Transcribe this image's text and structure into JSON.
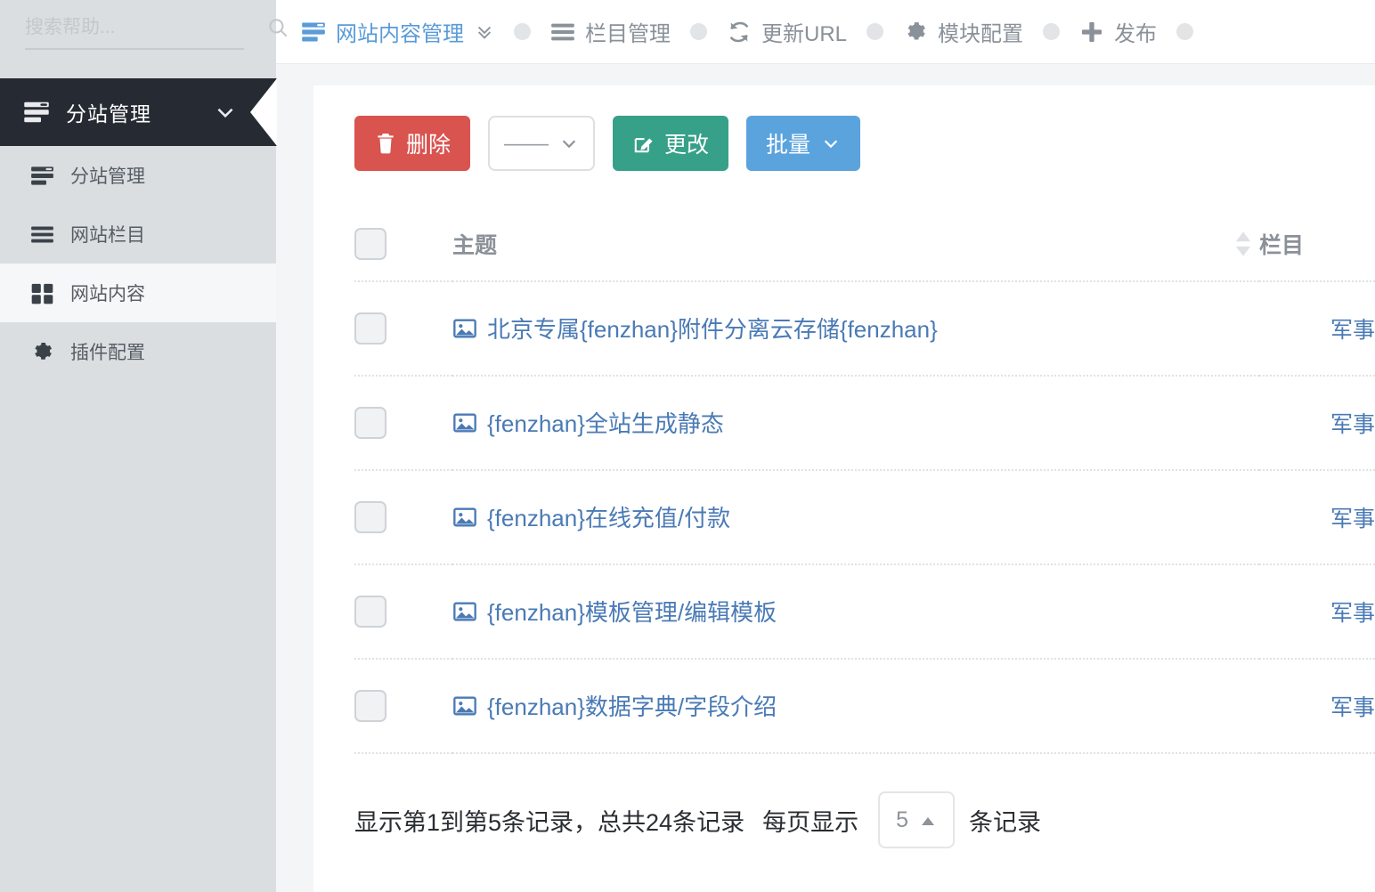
{
  "sidebar": {
    "search": {
      "placeholder": "搜索帮助...",
      "value": "",
      "icon": "search-icon"
    },
    "group": {
      "label": "分站管理",
      "icon": "server-list-icon",
      "chevron": "chevron-down-icon"
    },
    "items": [
      {
        "label": "分站管理",
        "icon": "server-list-icon",
        "active": false
      },
      {
        "label": "网站栏目",
        "icon": "list-icon",
        "active": false
      },
      {
        "label": "网站内容",
        "icon": "grid-icon",
        "active": true
      },
      {
        "label": "插件配置",
        "icon": "gear-icon",
        "active": false
      }
    ]
  },
  "topbar": {
    "items": [
      {
        "label": "网站内容管理",
        "icon": "server-list-icon",
        "primary": true,
        "chevron": "chevron-double-down-icon"
      },
      {
        "label": "栏目管理",
        "icon": "list-icon",
        "primary": false
      },
      {
        "label": "更新URL",
        "icon": "refresh-icon",
        "primary": false
      },
      {
        "label": "模块配置",
        "icon": "gear-icon",
        "primary": false
      },
      {
        "label": "发布",
        "icon": "plus-icon",
        "primary": false
      }
    ]
  },
  "toolbar": {
    "delete_label": "删除",
    "delete_icon": "trash-icon",
    "select_value": "——",
    "select_chevron": "chevron-down-icon",
    "edit_label": "更改",
    "edit_icon": "pencil-square-icon",
    "batch_label": "批量",
    "batch_chevron": "chevron-down-icon"
  },
  "table": {
    "columns": {
      "subject": "主题",
      "category": "栏目"
    },
    "sort_icon": "sort-icon",
    "rows": [
      {
        "title": "北京专属{fenzhan}附件分离云存储{fenzhan}",
        "category": "军事",
        "icon": "image-icon"
      },
      {
        "title": "{fenzhan}全站生成静态",
        "category": "军事",
        "icon": "image-icon"
      },
      {
        "title": "{fenzhan}在线充值/付款",
        "category": "军事",
        "icon": "image-icon"
      },
      {
        "title": "{fenzhan}模板管理/编辑模板",
        "category": "军事",
        "icon": "image-icon"
      },
      {
        "title": "{fenzhan}数据字典/字段介绍",
        "category": "军事",
        "icon": "image-icon"
      }
    ]
  },
  "footer": {
    "info_prefix": "显示第1到第5条记录，总共24条记录",
    "per_page_label": "每页显示",
    "page_size": "5",
    "page_size_caret": "caret-up-icon",
    "records_suffix": "条记录"
  },
  "colors": {
    "accent_blue": "#5a9bd8",
    "link_blue": "#4a7ab5",
    "danger": "#d9534f",
    "success": "#36a188",
    "info": "#5ba3dd",
    "sidebar_bg": "#dadee1",
    "sidebar_header_bg": "#262b33",
    "content_bg": "#f4f5f7"
  }
}
